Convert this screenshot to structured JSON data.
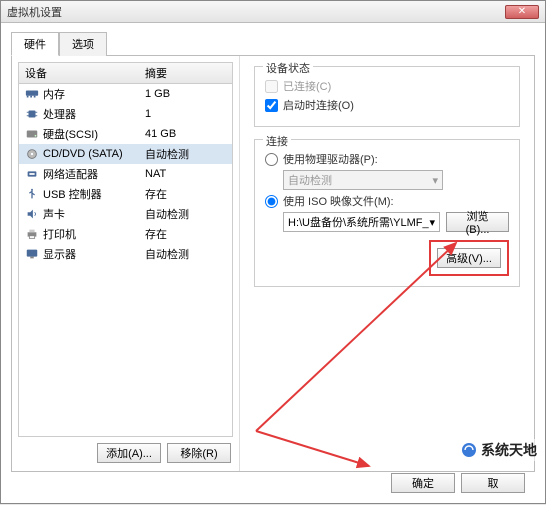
{
  "window": {
    "title": "虚拟机设置"
  },
  "tabs": {
    "hardware": "硬件",
    "options": "选项",
    "active": 0
  },
  "columns": {
    "device": "设备",
    "summary": "摘要"
  },
  "devices": [
    {
      "icon": "memory",
      "name": "内存",
      "summary": "1 GB"
    },
    {
      "icon": "cpu",
      "name": "处理器",
      "summary": "1"
    },
    {
      "icon": "disk",
      "name": "硬盘(SCSI)",
      "summary": "41 GB"
    },
    {
      "icon": "cd",
      "name": "CD/DVD (SATA)",
      "summary": "自动检测",
      "selected": true
    },
    {
      "icon": "net",
      "name": "网络适配器",
      "summary": "NAT"
    },
    {
      "icon": "usb",
      "name": "USB 控制器",
      "summary": "存在"
    },
    {
      "icon": "sound",
      "name": "声卡",
      "summary": "自动检测"
    },
    {
      "icon": "printer",
      "name": "打印机",
      "summary": "存在"
    },
    {
      "icon": "display",
      "name": "显示器",
      "summary": "自动检测"
    }
  ],
  "buttons": {
    "add": "添加(A)...",
    "remove": "移除(R)",
    "browse": "浏览(B)...",
    "advanced": "高级(V)...",
    "ok": "确定",
    "cancel": "取"
  },
  "status": {
    "legend": "设备状态",
    "connected": "已连接(C)",
    "connect_at_power": "启动时连接(O)",
    "connected_checked": false,
    "connected_enabled": false,
    "power_checked": true
  },
  "connection": {
    "legend": "连接",
    "use_physical": "使用物理驱动器(P):",
    "physical_value": "自动检测",
    "use_iso": "使用 ISO 映像文件(M):",
    "iso_value": "H:\\U盘备份\\系统所需\\YLMF_",
    "selected": "iso"
  },
  "watermark": {
    "text": "系统天地"
  },
  "colors": {
    "highlight": "#e23a3a",
    "selection": "#d7e4f2"
  }
}
